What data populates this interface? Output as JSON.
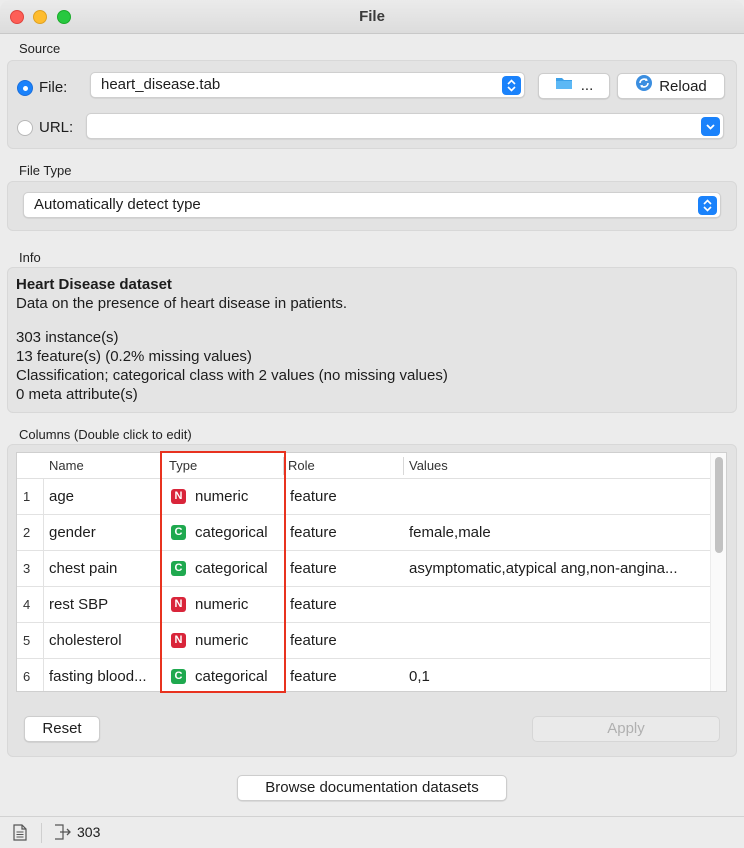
{
  "window": {
    "title": "File"
  },
  "source": {
    "label": "Source",
    "file_label": "File:",
    "file_value": "heart_disease.tab",
    "browse_label": "...",
    "reload_label": "Reload",
    "url_label": "URL:",
    "url_value": ""
  },
  "file_type": {
    "label": "File Type",
    "value": "Automatically detect type"
  },
  "info": {
    "label": "Info",
    "title": "Heart Disease dataset",
    "description": "Data on the presence of heart disease in patients.",
    "instances": "303 instance(s)",
    "features": "13 feature(s) (0.2% missing values)",
    "classification": "Classification; categorical class with 2 values (no missing values)",
    "meta": "0 meta attribute(s)"
  },
  "columns": {
    "label": "Columns (Double click to edit)",
    "headers": {
      "name": "Name",
      "type": "Type",
      "role": "Role",
      "values": "Values"
    },
    "rows": [
      {
        "num": "1",
        "name": "age",
        "badge": "N",
        "type": "numeric",
        "role": "feature",
        "values": ""
      },
      {
        "num": "2",
        "name": "gender",
        "badge": "C",
        "type": "categorical",
        "role": "feature",
        "values": "female,male"
      },
      {
        "num": "3",
        "name": "chest pain",
        "badge": "C",
        "type": "categorical",
        "role": "feature",
        "values": "asymptomatic,atypical ang,non-angina..."
      },
      {
        "num": "4",
        "name": "rest SBP",
        "badge": "N",
        "type": "numeric",
        "role": "feature",
        "values": ""
      },
      {
        "num": "5",
        "name": "cholesterol",
        "badge": "N",
        "type": "numeric",
        "role": "feature",
        "values": ""
      },
      {
        "num": "6",
        "name": "fasting blood...",
        "badge": "C",
        "type": "categorical",
        "role": "feature",
        "values": "0,1"
      }
    ],
    "reset_label": "Reset",
    "apply_label": "Apply"
  },
  "browse_docs_label": "Browse documentation datasets",
  "status": {
    "output_count": "303"
  },
  "colors": {
    "numeric_badge": "#d9253a",
    "categorical_badge": "#1fa94f",
    "accent": "#1a82fb",
    "highlight": "#e8321f"
  }
}
